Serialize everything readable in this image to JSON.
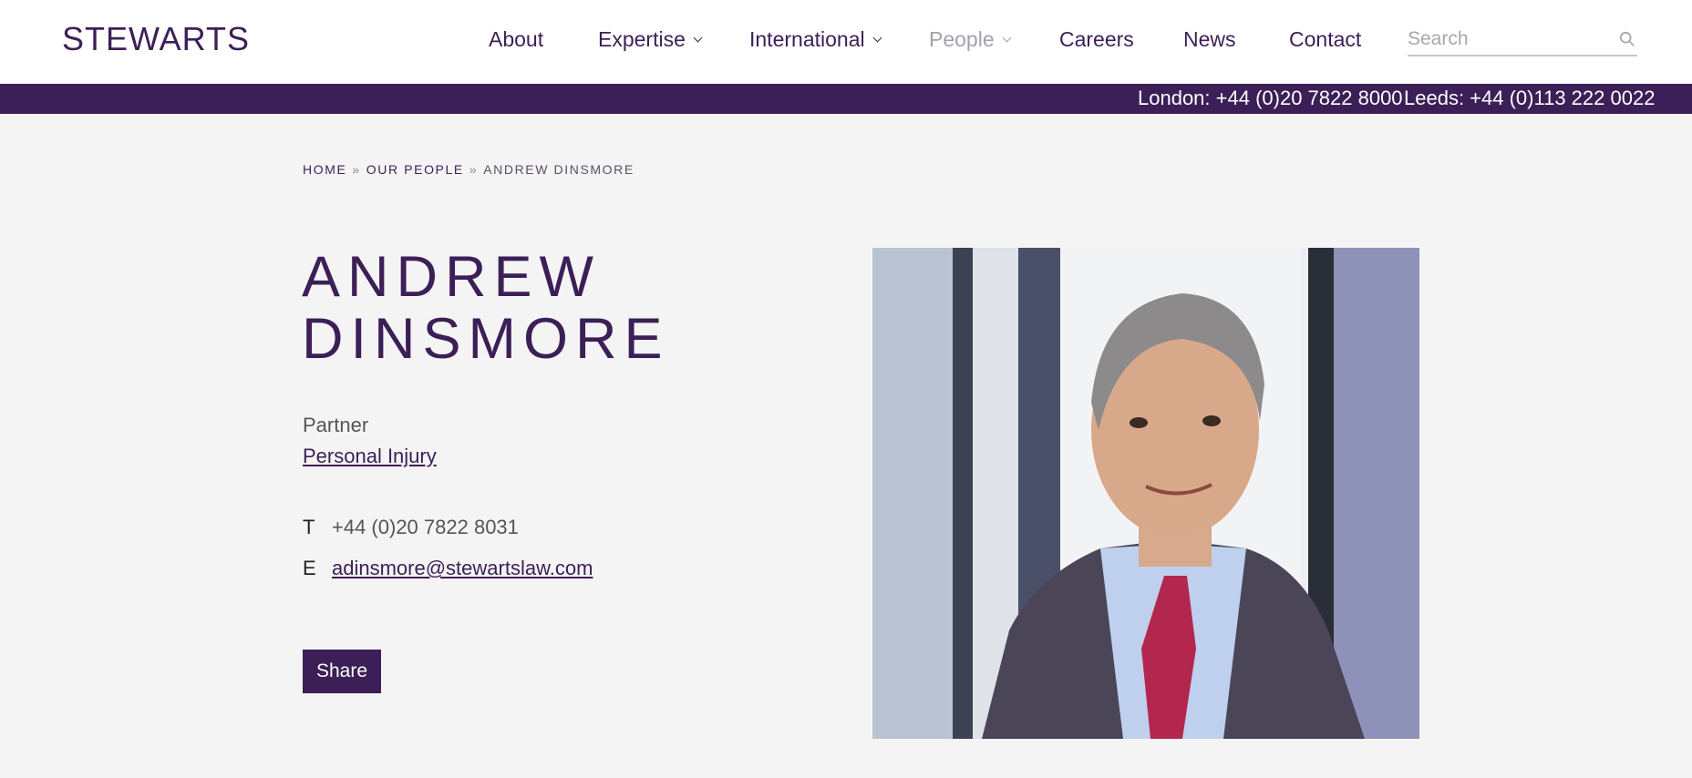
{
  "header": {
    "logo": "STEWARTS",
    "nav": [
      {
        "label": "About"
      },
      {
        "label": "Expertise"
      },
      {
        "label": "International"
      },
      {
        "label": "People"
      },
      {
        "label": "Careers"
      },
      {
        "label": "News"
      },
      {
        "label": "Contact"
      }
    ],
    "search_placeholder": "Search"
  },
  "phone_bar": {
    "london": "London: +44 (0)20 7822 8000",
    "leeds": "Leeds: +44 (0)113 222 0022"
  },
  "breadcrumb": {
    "home": "HOME",
    "separator": "»",
    "people": "OUR PEOPLE",
    "current": "ANDREW DINSMORE"
  },
  "profile": {
    "first_name": "ANDREW",
    "last_name": "DINSMORE",
    "role": "Partner",
    "practice": "Personal Injury",
    "phone_label": "T",
    "phone": "+44 (0)20 7822 8031",
    "email_label": "E",
    "email": "adinsmore@stewartslaw.com",
    "share_label": "Share"
  },
  "colors": {
    "brand": "#3c1f57",
    "background": "#f4f4f4",
    "muted_nav": "#a3a0aa"
  }
}
